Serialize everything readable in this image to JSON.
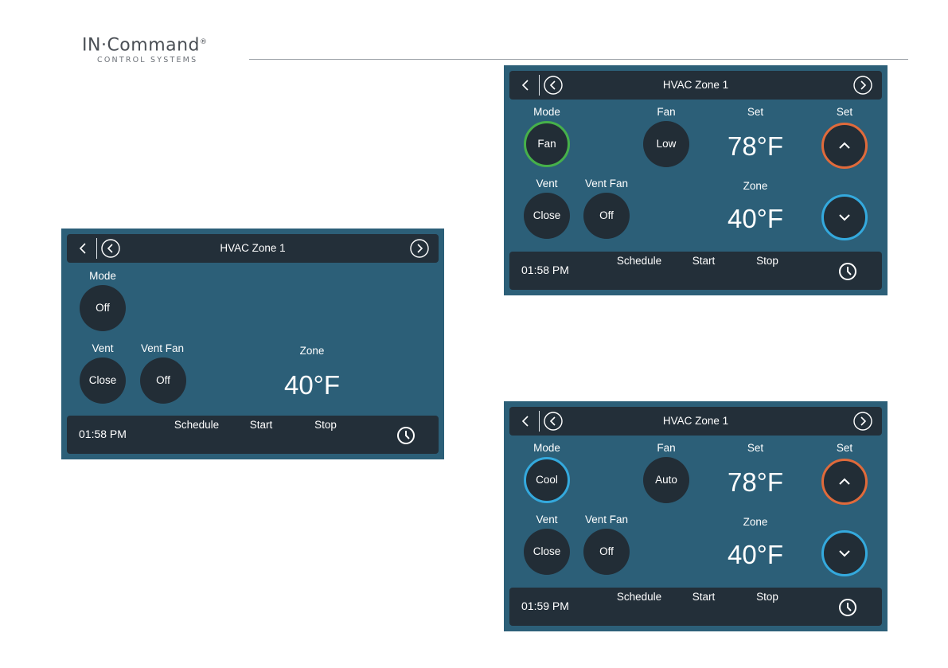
{
  "brand": {
    "name": "IN·Command",
    "reg": "®",
    "subtitle": "CONTROL SYSTEMS"
  },
  "colors": {
    "panel": "#2c5f78",
    "bar": "#232f39",
    "mode_fan": "#46b04a",
    "mode_cool": "#34a9dd",
    "set_up": "#e06a3b",
    "set_down": "#34a9dd"
  },
  "screen1": {
    "title": "HVAC Zone 1",
    "mode_label": "Mode",
    "mode_value": "Off",
    "vent_label": "Vent",
    "vent_value": "Close",
    "vent_fan_label": "Vent Fan",
    "vent_fan_value": "Off",
    "zone_label": "Zone",
    "zone_temp": "40°F",
    "time": "01:58 PM",
    "schedule": "Schedule",
    "start": "Start",
    "stop": "Stop"
  },
  "screen2": {
    "title": "HVAC Zone 1",
    "mode_label": "Mode",
    "mode_value": "Fan",
    "fan_label": "Fan",
    "fan_value": "Low",
    "set_label": "Set",
    "set_temp": "78°F",
    "set_buttons_label": "Set",
    "vent_label": "Vent",
    "vent_value": "Close",
    "vent_fan_label": "Vent Fan",
    "vent_fan_value": "Off",
    "zone_label": "Zone",
    "zone_temp": "40°F",
    "time": "01:58 PM",
    "schedule": "Schedule",
    "start": "Start",
    "stop": "Stop"
  },
  "screen3": {
    "title": "HVAC Zone 1",
    "mode_label": "Mode",
    "mode_value": "Cool",
    "fan_label": "Fan",
    "fan_value": "Auto",
    "set_label": "Set",
    "set_temp": "78°F",
    "set_buttons_label": "Set",
    "vent_label": "Vent",
    "vent_value": "Close",
    "vent_fan_label": "Vent Fan",
    "vent_fan_value": "Off",
    "zone_label": "Zone",
    "zone_temp": "40°F",
    "time": "01:59 PM",
    "schedule": "Schedule",
    "start": "Start",
    "stop": "Stop"
  }
}
